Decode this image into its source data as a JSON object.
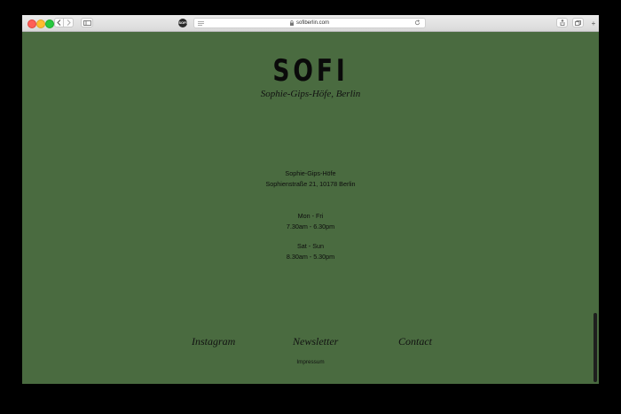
{
  "browser": {
    "url": "sofiberlin.com",
    "favicon_text": "SOFI",
    "new_tab_symbol": "+"
  },
  "page": {
    "logo": "SOFI",
    "tagline": "Sophie-Gips-Höfe, Berlin",
    "address": {
      "line1": "Sophie-Gips-Höfe",
      "line2": "Sophienstraße 21, 10178 Berlin"
    },
    "hours": {
      "weekday_label": "Mon - Fri",
      "weekday_time": "7.30am - 6.30pm",
      "weekend_label": "Sat - Sun",
      "weekend_time": "8.30am - 5.30pm"
    },
    "footer": {
      "instagram": "Instagram",
      "newsletter": "Newsletter",
      "contact": "Contact",
      "impressum": "Impressum"
    }
  },
  "colors": {
    "page_background": "#4a6b40",
    "text": "#0b0b0b"
  }
}
